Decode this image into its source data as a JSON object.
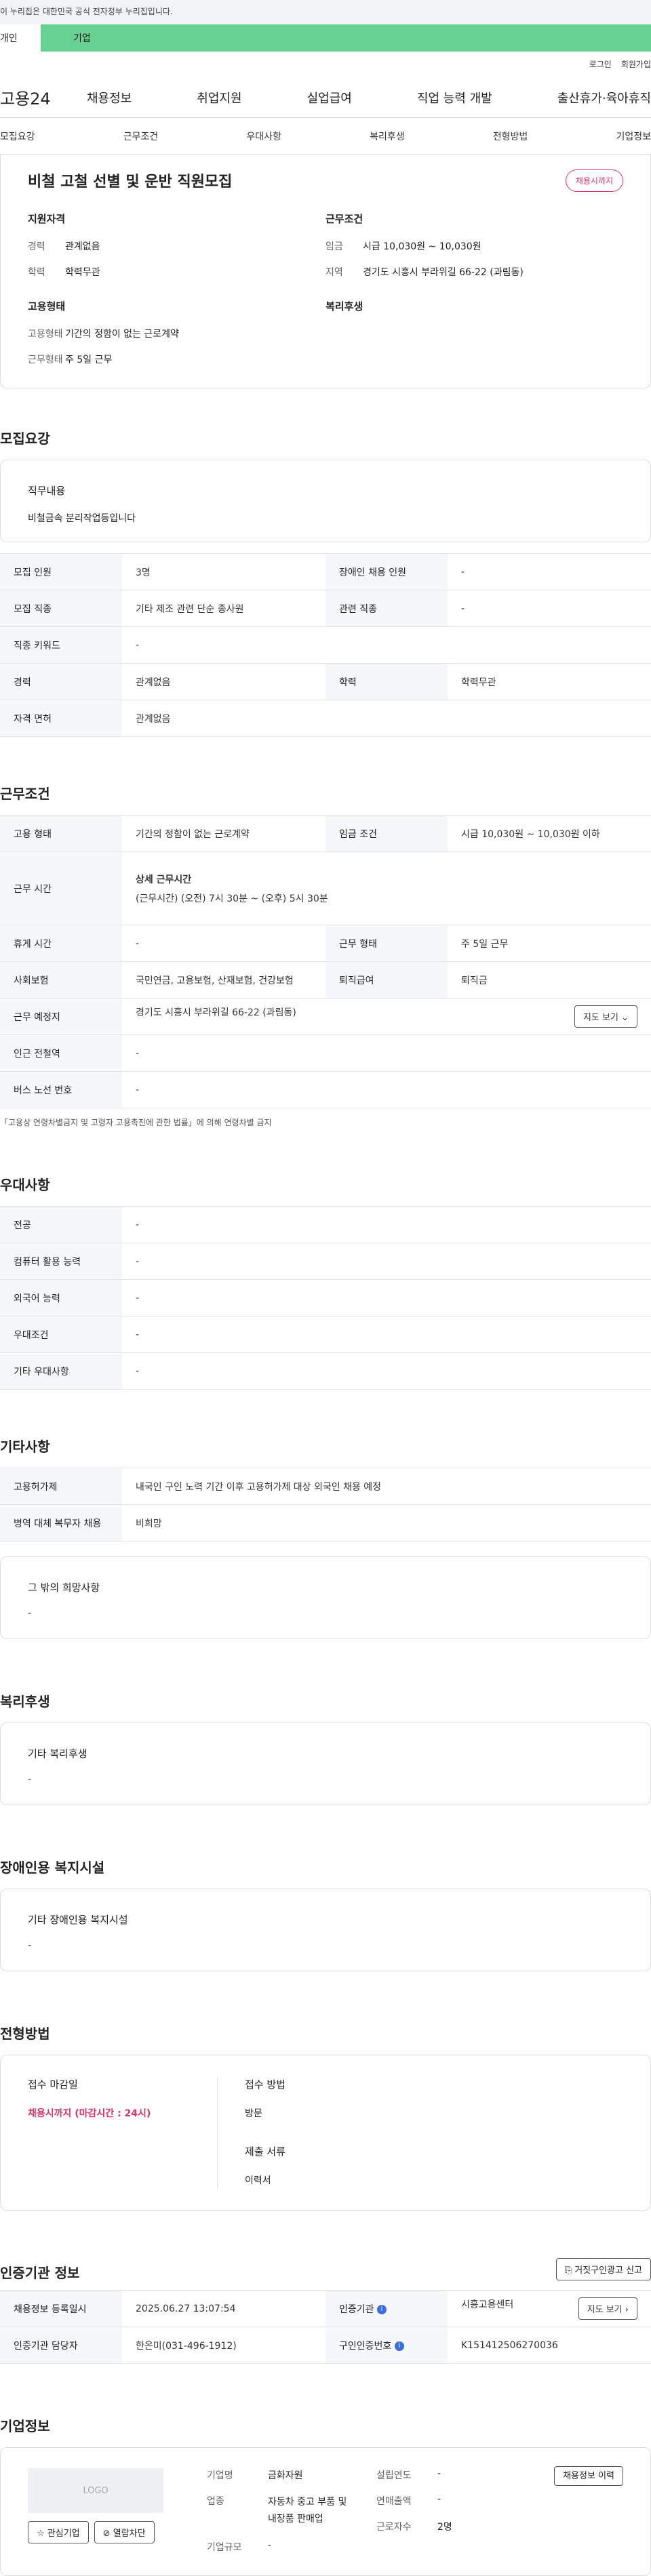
{
  "banner": "이 누리집은 대한민국 공식 전자정부 누리집입니다.",
  "tabs": [
    "개인",
    "기업"
  ],
  "util": [
    "로그인",
    "회원가입"
  ],
  "logo": "고용24",
  "gnb": [
    "채용정보",
    "취업지원",
    "실업급여",
    "직업 능력 개발",
    "출산휴가·육아휴직"
  ],
  "subnav": [
    "모집요강",
    "근무조건",
    "우대사항",
    "복리후생",
    "전형방법",
    "기업정보"
  ],
  "summary": {
    "title": "비철 고철 선별 및 운반 직원모집",
    "badge": "채용시까지",
    "qual_title": "지원자격",
    "career_k": "경력",
    "career_v": "관계없음",
    "edu_k": "학력",
    "edu_v": "학력무관",
    "cond_title": "근무조건",
    "wage_k": "임금",
    "wage_v": "시급 10,030원 ~ 10,030원",
    "region_k": "지역",
    "region_v": "경기도 시흥시 부라위길 66-22 (과림동)",
    "emp_title": "고용형태",
    "emptype_k": "고용형태",
    "emptype_v": "기간의 정함이 없는 근로계약",
    "workform_k": "근무형태",
    "workform_v": "주 5일 근무",
    "welfare_title": "복리후생"
  },
  "recruit": {
    "title": "모집요강",
    "job_h": "직무내용",
    "job_v": "비철금속 분리작업등입니다",
    "rows": [
      [
        "모집 인원",
        "3명",
        "장애인 채용 인원",
        "-"
      ],
      [
        "모집 직종",
        "기타 제조 관련 단순 종사원",
        "관련 직종",
        "-"
      ],
      [
        "직종 키워드",
        "-"
      ],
      [
        "경력",
        "관계없음",
        "학력",
        "학력무관"
      ],
      [
        "자격 면허",
        "관계없음"
      ]
    ]
  },
  "work": {
    "title": "근무조건",
    "emp_k": "고용 형태",
    "emp_v": "기간의 정함이 없는 근로계약",
    "wage_k": "임금 조건",
    "wage_v": "시급 10,030원 ~ 10,030원 이하",
    "time_k": "근무 시간",
    "time_h": "상세 근무시간",
    "time_v": "(근무시간) (오전) 7시 30분 ~ (오후) 5시 30분",
    "rest_k": "휴게 시간",
    "rest_v": "-",
    "form_k": "근무 형태",
    "form_v": "주 5일 근무",
    "ins_k": "사회보험",
    "ins_v": "국민연금, 고용보험, 산재보험, 건강보험",
    "sev_k": "퇴직급여",
    "sev_v": "퇴직금",
    "place_k": "근무 예정지",
    "place_v": "경기도 시흥시 부라위길 66-22 (과림동)",
    "map_btn": "지도 보기",
    "sub_k": "인근 전철역",
    "sub_v": "-",
    "bus_k": "버스 노선 번호",
    "bus_v": "-",
    "note": "「고용상 연령차별금지 및 고령자 고용촉진에 관한 법률」에 의해 연령차별 금지"
  },
  "pref": {
    "title": "우대사항",
    "rows": [
      [
        "전공",
        "-"
      ],
      [
        "컴퓨터 활용 능력",
        "-"
      ],
      [
        "외국어 능력",
        "-"
      ],
      [
        "우대조건",
        "-"
      ],
      [
        "기타 우대사항",
        "-"
      ]
    ]
  },
  "etc": {
    "title": "기타사항",
    "rows": [
      [
        "고용허가제",
        "내국인 구인 노력 기간 이후 고용허가제 대상 외국인 채용 예정"
      ],
      [
        "병역 대체 복무자 채용",
        "비희망"
      ]
    ],
    "wish_h": "그 밖의 희망사항",
    "wish_v": "-"
  },
  "welfare": {
    "title": "복리후생",
    "h": "기타 복리후생",
    "v": "-"
  },
  "disab": {
    "title": "장애인용 복지시설",
    "h": "기타 장애인용 복지시설",
    "v": "-"
  },
  "apply": {
    "title": "전형방법",
    "deadline_h": "접수 마감일",
    "deadline_v": "채용시까지 (마감시간 : 24시)",
    "method_h": "접수 방법",
    "method_v": "방문",
    "docs_h": "제출 서류",
    "docs_v": "이력서"
  },
  "cert": {
    "title": "인증기관 정보",
    "report_btn": "거짓구인광고 신고",
    "reg_k": "채용정보 등록일시",
    "reg_v": "2025.06.27 13:07:54",
    "org_k": "인증기관",
    "org_v": "시흥고용센터",
    "map_btn": "지도 보기",
    "mgr_k": "인증기관 담당자",
    "mgr_v": "한은미(031-496-1912)",
    "cert_k": "구인인증번호",
    "cert_v": "K151412506270036"
  },
  "company": {
    "title": "기업정보",
    "logo": "LOGO",
    "fav_btn": "관심기업",
    "block_btn": "열람차단",
    "name_k": "기업명",
    "name_v": "금화자원",
    "ind_k": "업종",
    "ind_v": "자동차 중고 부품 및 내장품 판매업",
    "size_k": "기업규모",
    "size_v": "-",
    "est_k": "설립연도",
    "est_v": "-",
    "sales_k": "연매출액",
    "sales_v": "-",
    "emp_k": "근로자수",
    "emp_v": "2명",
    "history_btn": "채용정보 이력"
  }
}
